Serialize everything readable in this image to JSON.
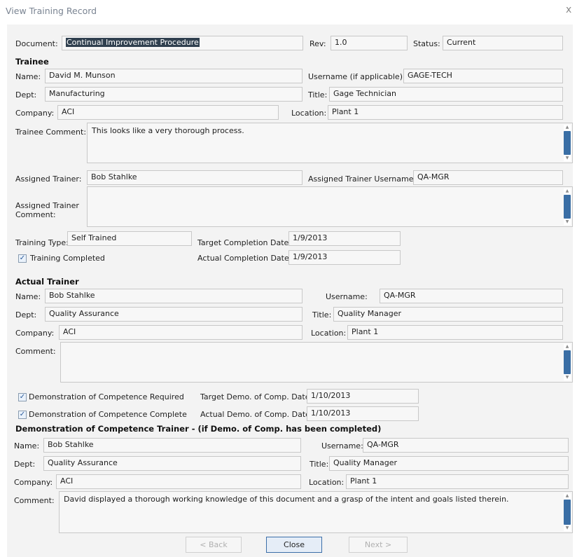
{
  "window": {
    "title": "View Training Record",
    "close_glyph": "x"
  },
  "document": {
    "label": "Document:",
    "value": "Continual Improvement Procedure",
    "rev_label": "Rev:",
    "rev_value": "1.0",
    "status_label": "Status:",
    "status_value": "Current"
  },
  "trainee": {
    "heading": "Trainee",
    "name_label": "Name:",
    "name": "David M. Munson",
    "username_label": "Username (if applicable):",
    "username": "GAGE-TECH",
    "dept_label": "Dept:",
    "dept": "Manufacturing",
    "title_label": "Title:",
    "title": "Gage Technician",
    "company_label": "Company:",
    "company": "ACI",
    "location_label": "Location:",
    "location": "Plant 1",
    "comment_label": "Trainee Comment:",
    "comment": "This looks like a very thorough process."
  },
  "assigned": {
    "trainer_label": "Assigned Trainer:",
    "trainer": "Bob  Stahlke",
    "username_label": "Assigned Trainer Username:",
    "username": "QA-MGR",
    "comment_label_1": "Assigned Trainer",
    "comment_label_2": "Comment:",
    "comment": ""
  },
  "training": {
    "type_label": "Training Type:",
    "type": "Self Trained",
    "target_label": "Target Completion Date:",
    "target_date": "1/9/2013",
    "completed_label": "Training Completed",
    "completed": true,
    "actual_label": "Actual Completion Date:",
    "actual_date": "1/9/2013"
  },
  "actual_trainer": {
    "heading": "Actual Trainer",
    "name_label": "Name:",
    "name": "Bob  Stahlke",
    "username_label": "Username:",
    "username": "QA-MGR",
    "dept_label": "Dept:",
    "dept": "Quality Assurance",
    "title_label": "Title:",
    "title": "Quality Manager",
    "company_label": "Company:",
    "company": "ACI",
    "location_label": "Location:",
    "location": "Plant 1",
    "comment_label": "Comment:",
    "comment": ""
  },
  "demo": {
    "required_label": "Demonstration of Competence Required",
    "required": true,
    "target_label": "Target Demo. of Comp. Date:",
    "target_date": "1/10/2013",
    "complete_label": "Demonstration of Competence Complete",
    "complete": true,
    "actual_label": "Actual Demo. of Comp. Date:",
    "actual_date": "1/10/2013"
  },
  "demo_trainer": {
    "heading": "Demonstration of Competence Trainer - (if Demo. of Comp. has been completed)",
    "name_label": "Name:",
    "name": "Bob  Stahlke",
    "username_label": "Username:",
    "username": "QA-MGR",
    "dept_label": "Dept:",
    "dept": "Quality Assurance",
    "title_label": "Title:",
    "title": "Quality Manager",
    "company_label": "Company:",
    "company": "ACI",
    "location_label": "Location:",
    "location": "Plant 1",
    "comment_label": "Comment:",
    "comment": "David displayed a thorough working knowledge of this document and a grasp of the intent and goals listed therein."
  },
  "buttons": {
    "back": "< Back",
    "close": "Close",
    "next": "Next >"
  },
  "colors": {
    "accent": "#3a6ea5",
    "selection": "#30404f",
    "field_bg": "#f7f7f7",
    "panel_bg": "#f3f3f3"
  },
  "icons": {
    "checkbox": "check-mark-icon",
    "scroll_up": "triangle-up-icon",
    "scroll_down": "triangle-down-icon"
  }
}
